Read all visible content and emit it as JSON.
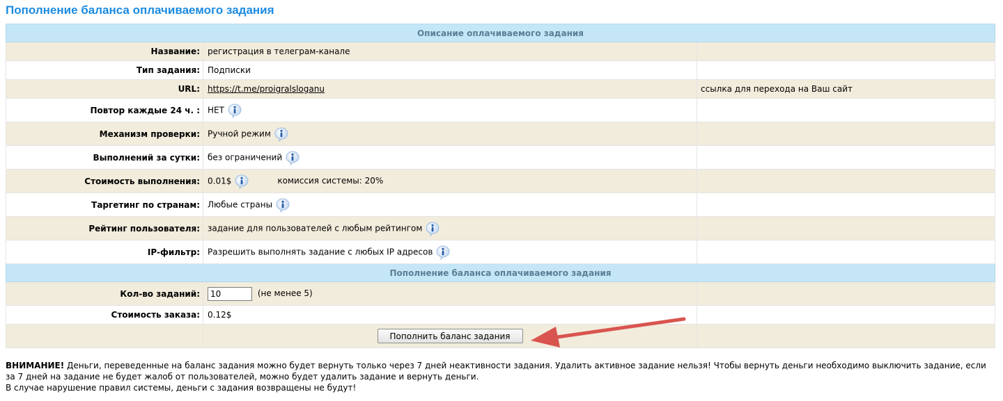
{
  "page_title": "Пополнение баланса оплачиваемого задания",
  "sections": {
    "description": "Описание оплачиваемого задания",
    "topup": "Пополнение баланса оплачиваемого задания"
  },
  "fields": {
    "name": {
      "label": "Название:",
      "value": "регистрация в телеграм-канале"
    },
    "type": {
      "label": "Тип задания:",
      "value": "Подписки"
    },
    "url": {
      "label": "URL:",
      "value": "https://t.me/proigralsloganu",
      "note": "ссылка для перехода на Ваш сайт"
    },
    "repeat": {
      "label": "Повтор каждые 24 ч. :",
      "value": "НЕТ"
    },
    "check": {
      "label": "Механизм проверки:",
      "value": "Ручной режим"
    },
    "per_day": {
      "label": "Выполнений за сутки:",
      "value": "без ограничений"
    },
    "cost": {
      "label": "Стоимость выполнения:",
      "value": "0.01$",
      "commission": "комиссия системы: 20%"
    },
    "targeting": {
      "label": "Таргетинг по странам:",
      "value": "Любые страны"
    },
    "rating": {
      "label": "Рейтинг пользователя:",
      "value": "задание для пользователей с любым рейтингом"
    },
    "ip_filter": {
      "label": "IP-фильтр:",
      "value": "Разрешить выполнять задание с любых IP адресов"
    }
  },
  "topup": {
    "quantity_label": "Кол-во заданий:",
    "quantity_value": "10",
    "quantity_hint": "(не менее 5)",
    "order_cost_label": "Стоимость заказа:",
    "order_cost_value": "0.12$",
    "submit_label": "Пополнить баланс задания"
  },
  "warning": {
    "title": "ВНИМАНИЕ!",
    "line1": "Деньги, переведенные на баланс задания можно будет вернуть только через 7 дней неактивности задания. Удалить активное задание нельзя! Чтобы вернуть деньги необходимо выключить задание, если за 7 дней на задание не будет жалоб от пользователей, можно будет удалить задание и вернуть деньги.",
    "line2": "В случае нарушение правил системы, деньги с задания возвращены не будут!"
  },
  "icons": {
    "info": "info-icon",
    "arrow": "red-arrow-annotation"
  },
  "colors": {
    "title": "#1b8be0",
    "section_bg": "#c4e6f7",
    "row_alt": "#f2ecdc",
    "arrow": "#d9544f"
  }
}
